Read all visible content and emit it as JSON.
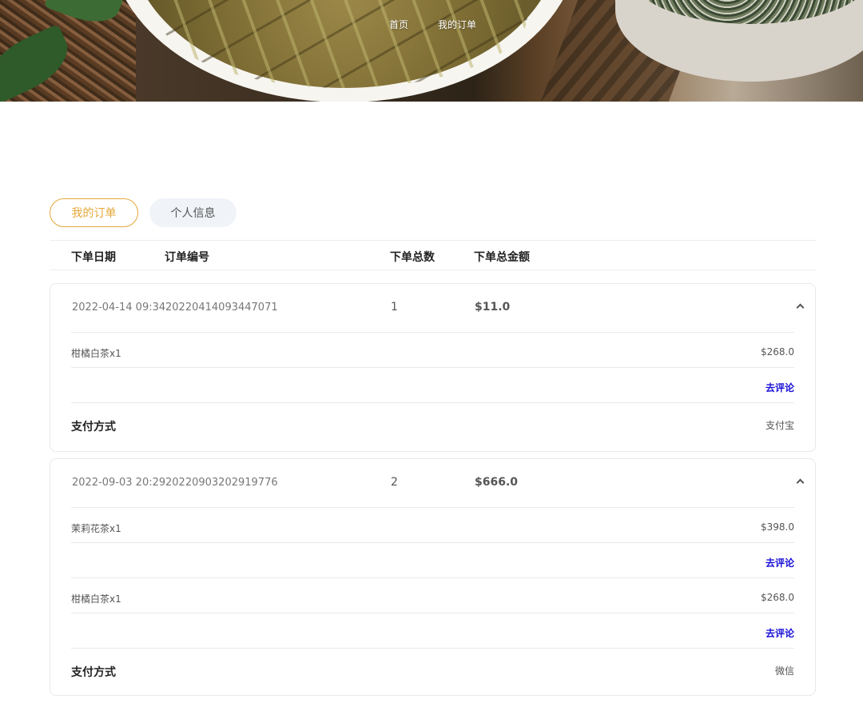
{
  "nav": {
    "home": "首页",
    "orders": "我的订单"
  },
  "tabs": {
    "orders": "我的订单",
    "profile": "个人信息"
  },
  "header": {
    "date": "下单日期",
    "order_no": "订单编号",
    "count": "下单总数",
    "total": "下单总金额"
  },
  "pay_label": "支付方式",
  "review_label": "去评论",
  "orders": [
    {
      "date": "2022-04-14 09:34",
      "order_no": "20220414093447071",
      "count": "1",
      "total": "$11.0",
      "items": [
        {
          "name": "柑橘白茶x1",
          "price": "$268.0"
        }
      ],
      "payment": "支付宝"
    },
    {
      "date": "2022-09-03 20:29",
      "order_no": "20220903202919776",
      "count": "2",
      "total": "$666.0",
      "items": [
        {
          "name": "茉莉花茶x1",
          "price": "$398.0"
        },
        {
          "name": "柑橘白茶x1",
          "price": "$268.0"
        }
      ],
      "payment": "微信"
    }
  ]
}
